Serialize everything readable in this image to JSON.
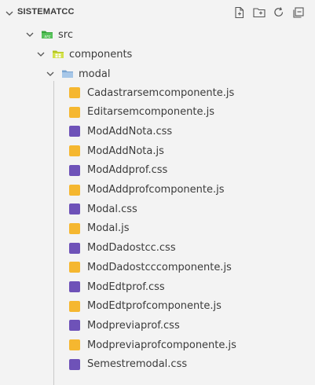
{
  "explorer": {
    "title": "SISTEMATCC",
    "actions": [
      "new-file-icon",
      "new-folder-icon",
      "refresh-icon",
      "collapse-all-icon"
    ],
    "folders": {
      "src": "src",
      "components": "components",
      "modal": "modal"
    },
    "files": [
      {
        "name": "Cadastrarsemcomponente.js",
        "type": "js"
      },
      {
        "name": "Editarsemcomponente.js",
        "type": "js"
      },
      {
        "name": "ModAddNota.css",
        "type": "css"
      },
      {
        "name": "ModAddNota.js",
        "type": "js"
      },
      {
        "name": "ModAddprof.css",
        "type": "css"
      },
      {
        "name": "ModAddprofcomponente.js",
        "type": "js"
      },
      {
        "name": "Modal.css",
        "type": "css"
      },
      {
        "name": "Modal.js",
        "type": "js"
      },
      {
        "name": "ModDadostcc.css",
        "type": "css"
      },
      {
        "name": "ModDadostcccomponente.js",
        "type": "js"
      },
      {
        "name": "ModEdtprof.css",
        "type": "css"
      },
      {
        "name": "ModEdtprofcomponente.js",
        "type": "js"
      },
      {
        "name": "Modpreviaprof.css",
        "type": "css"
      },
      {
        "name": "Modpreviaprofcomponente.js",
        "type": "js"
      },
      {
        "name": "Semestremodal.css",
        "type": "css"
      }
    ],
    "colors": {
      "js": "#f5b730",
      "css": "#6e52b8",
      "folder": "#8fb6dd",
      "src_folder": "#37a33c",
      "components_folder": "#c4d62f"
    }
  }
}
